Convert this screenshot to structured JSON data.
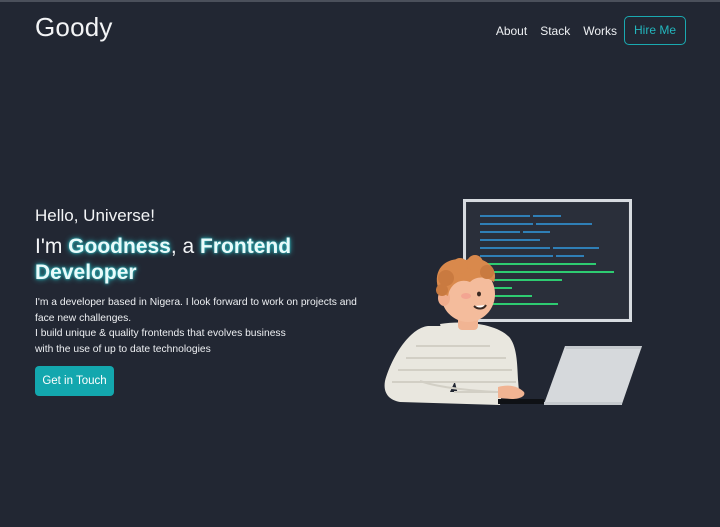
{
  "brand": {
    "logo": "Goody"
  },
  "nav": {
    "items": [
      "About",
      "Stack",
      "Works"
    ],
    "cta": "Hire Me"
  },
  "hero": {
    "greeting": "Hello, Universe!",
    "intro_prefix": "I'm ",
    "name": "Goodness",
    "connector": ", a ",
    "role": "Frontend Developer",
    "desc_line1": "I'm a developer based in Nigera. I look forward to work on projects and face new challenges.",
    "desc_line2": "I build unique & quality frontends that evolves business",
    "desc_line3": "with the use of up to date technologies",
    "button": "Get in Touch"
  },
  "colors": {
    "background": "#222733",
    "accent": "#13a7ae",
    "code_green": "#2ecc71",
    "code_blue": "#2f7fb6"
  },
  "illustration": {
    "icon": "developer-at-laptop-illustration"
  }
}
